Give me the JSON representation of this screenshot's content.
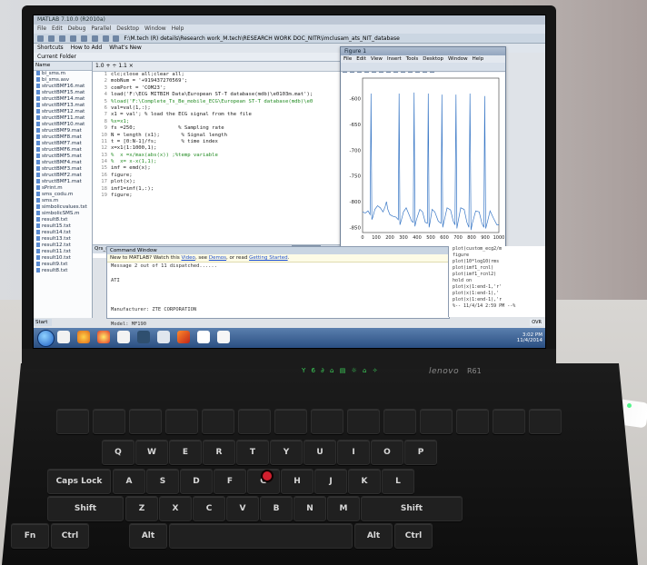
{
  "matlab": {
    "window_title": "MATLAB 7.10.0 (R2010a)",
    "menu": [
      "File",
      "Edit",
      "Debug",
      "Parallel",
      "Desktop",
      "Window",
      "Help"
    ],
    "toolbar_path": "F:\\M.tech (R) details\\Research work_M.tech\\RESEARCH WORK DOC_NITR\\imclusam_ats_NIT_database",
    "shortcuts": [
      "Shortcuts",
      "How to Add",
      "What's New"
    ],
    "current_folder_label": "Current Folder",
    "cwd": "F:\\M.tech (R) details\\Research work_M.tech\\RESEARCH WORK DOC_NITR\\imclusam_ats_NIT_database",
    "file_browser_header": "Name",
    "files": [
      "bi_sms.m",
      "bi_sms.asv",
      "structBMF16.mat",
      "structBMF15.mat",
      "structBMF14.mat",
      "structBMF13.mat",
      "structBMF12.mat",
      "structBMF11.mat",
      "structBMF10.mat",
      "structBMF9.mat",
      "structBMF8.mat",
      "structBMF7.mat",
      "structBMF6.mat",
      "structBMF5.mat",
      "structBMF4.mat",
      "structBMF3.mat",
      "structBMF2.mat",
      "structBMF1.mat",
      "sPrint.m",
      "sms_codu.m",
      "sms.m",
      "simbolicvalues.txt",
      "simbolicSMS.m",
      "result8.txt",
      "result15.txt",
      "result14.txt",
      "result13.txt",
      "result12.txt",
      "result11.txt",
      "result10.txt",
      "result9.txt",
      "result8.txt"
    ],
    "editor_toolbar": "1.0   +   ÷ 1.1   ×",
    "code_lines": [
      {
        "n": "1",
        "text": "clc;close all;clear all;",
        "comment": false
      },
      {
        "n": "2",
        "text": "mobNum = '+919437270569';",
        "comment": false
      },
      {
        "n": "3",
        "text": "comPort = 'COM23';",
        "comment": false
      },
      {
        "n": "4",
        "text": "load('F:\\ECG MITBIH Data\\European ST-T database(mdb)\\e0103m.mat');",
        "comment": false
      },
      {
        "n": "5",
        "text": "%load('F:\\Complete_Ts_Be_mobile_ECG\\European ST-T database(mdb)\\e0",
        "comment": true
      },
      {
        "n": "6",
        "text": "val=val(1,:);",
        "comment": false
      },
      {
        "n": "7",
        "text": "x1 = val'; % load the ECG signal from the file",
        "comment": false
      },
      {
        "n": "8",
        "text": "%x=x1;",
        "comment": true
      },
      {
        "n": "9",
        "text": "fs =250;              % Sampling rate",
        "comment": false
      },
      {
        "n": "10",
        "text": "N = length (x1);       % Signal length",
        "comment": false
      },
      {
        "n": "11",
        "text": "t = [0:N-1]/fs;        % time index",
        "comment": false
      },
      {
        "n": "12",
        "text": "x=x1(1:1000,1);",
        "comment": false
      },
      {
        "n": "13",
        "text": "%  x =x/max(abs(x)) ;%temp variable",
        "comment": true
      },
      {
        "n": "14",
        "text": "%  x= x-x(1,1);",
        "comment": true
      },
      {
        "n": "15",
        "text": "imf = emd(x);",
        "comment": false
      },
      {
        "n": "16",
        "text": "figure;",
        "comment": false
      },
      {
        "n": "17",
        "text": "plot(x);",
        "comment": false
      },
      {
        "n": "18",
        "text": "imf1=imf(1,:);",
        "comment": false
      },
      {
        "n": "19",
        "text": "figure;",
        "comment": false
      }
    ],
    "tabs": [
      "Qrs_new_ncc_RP.m",
      "gkvrm.m",
      "comp_emd_gk.m",
      "Ischemia_ESTdata_r...",
      "bi_sms.m",
      "sms..."
    ],
    "active_tab": "bi_sms.m",
    "command_window_title": "Command Window",
    "notice": {
      "lead": "New to MATLAB? Watch this",
      "video": "Video",
      "mid": ", see",
      "demos": "Demos",
      "or": ", or read",
      "getting_started": "Getting Started",
      "end": "."
    },
    "command_lines": [
      "Message 2 out of 11 dispatched......",
      "",
      "ATI",
      "",
      "",
      "",
      "Manufacturer: ZTE CORPORATION",
      "",
      "Model: MF190"
    ],
    "history": [
      "plot(custom_ecg2/m",
      "figure",
      "plot(10*log10(rms",
      "plot(imf1_rcnl)",
      "plot(imf1_rcnl2)",
      "hold on",
      "plot(x(1:end-1,'r'",
      "plot(x(1:end-1),'",
      "plot(x(1:end-1),'r",
      "%-- 11/4/14  2:59 PM --%"
    ],
    "start_label": "Start",
    "ovr_label": "OVR"
  },
  "figure": {
    "title": "Figure 1",
    "menu": [
      "File",
      "Edit",
      "View",
      "Insert",
      "Tools",
      "Desktop",
      "Window",
      "Help"
    ]
  },
  "chart_data": {
    "type": "line",
    "title": "",
    "xlabel": "",
    "ylabel": "",
    "xlim": [
      0,
      1000
    ],
    "ylim": [
      -860,
      -560
    ],
    "xticks": [
      0,
      100,
      200,
      300,
      400,
      500,
      600,
      700,
      800,
      900,
      1000
    ],
    "yticks": [
      -850,
      -800,
      -750,
      -700,
      -650,
      -600
    ],
    "series": [
      {
        "color": "#3a78c6",
        "x": [
          0,
          20,
          40,
          55,
          62,
          68,
          75,
          90,
          110,
          130,
          150,
          165,
          175,
          185,
          200,
          220,
          245,
          262,
          268,
          274,
          285,
          300,
          320,
          345,
          360,
          372,
          378,
          384,
          395,
          420,
          440,
          460,
          475,
          482,
          488,
          495,
          510,
          530,
          555,
          575,
          582,
          588,
          598,
          620,
          645,
          665,
          678,
          685,
          692,
          700,
          720,
          745,
          765,
          780,
          788,
          795,
          805,
          830,
          855,
          875,
          890,
          896,
          903,
          915,
          935,
          960,
          985,
          1000
        ],
        "y": [
          -820,
          -822,
          -818,
          -825,
          -590,
          -835,
          -830,
          -815,
          -808,
          -812,
          -820,
          -810,
          -800,
          -815,
          -825,
          -828,
          -830,
          -835,
          -590,
          -845,
          -835,
          -820,
          -812,
          -828,
          -838,
          -840,
          -588,
          -848,
          -835,
          -815,
          -820,
          -840,
          -842,
          -590,
          -850,
          -840,
          -815,
          -820,
          -838,
          -842,
          -592,
          -850,
          -838,
          -812,
          -816,
          -838,
          -845,
          -592,
          -852,
          -840,
          -812,
          -815,
          -840,
          -850,
          -590,
          -855,
          -842,
          -818,
          -820,
          -842,
          -850,
          -595,
          -852,
          -840,
          -818,
          -832,
          -845,
          -845
        ]
      }
    ]
  },
  "taskbar": {
    "tray_time": "3:02 PM",
    "tray_date": "11/4/2014"
  },
  "hardware": {
    "brand": "lenovo",
    "model": "R61",
    "led_symbols": "Y 6  ∂ ⌂  ▤ ☼ ⌂ ✧",
    "keys": [
      {
        "label": "Q"
      },
      {
        "label": "W"
      },
      {
        "label": "E"
      },
      {
        "label": "R"
      },
      {
        "label": "T"
      },
      {
        "label": "Y"
      },
      {
        "label": "U"
      },
      {
        "label": "I"
      },
      {
        "label": "O"
      },
      {
        "label": "P"
      },
      {
        "label": "A"
      },
      {
        "label": "S"
      },
      {
        "label": "D"
      },
      {
        "label": "F"
      },
      {
        "label": "G"
      },
      {
        "label": "H"
      },
      {
        "label": "J"
      },
      {
        "label": "K"
      },
      {
        "label": "L"
      },
      {
        "label": "Z"
      },
      {
        "label": "X"
      },
      {
        "label": "C"
      },
      {
        "label": "V"
      },
      {
        "label": "B"
      },
      {
        "label": "N"
      },
      {
        "label": "M"
      },
      {
        "label": "Caps Lock"
      },
      {
        "label": "Shift"
      },
      {
        "label": "Alt"
      },
      {
        "label": "Ctrl"
      },
      {
        "label": "Fn"
      }
    ]
  }
}
